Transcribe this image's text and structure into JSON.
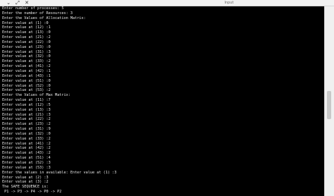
{
  "window": {
    "title": "Input",
    "buttons": [
      "⌄",
      "⤢",
      "✕"
    ]
  },
  "terminal": {
    "lines": [
      "Enter number of processes: 5",
      "Enter the number of Resources: 3",
      "Enter the Values of Allocation Matrix:",
      "Enter value at (1) :0",
      "Enter value at (12) :1",
      "Enter value at (13) :0",
      "Enter value at (21) :2",
      "Enter value at (22) :0",
      "Enter value at (23) :0",
      "Enter value at (31) :3",
      "Enter value at (32) :0",
      "Enter value at (33) :2",
      "Enter value at (41) :2",
      "Enter value at (42) :1",
      "Enter value at (43) :1",
      "Enter value at (51) :0",
      "Enter value at (52) :0",
      "Enter value at (53) :2",
      "Enter the Values of Max Matrix:",
      "Enter value at (11) :7",
      "Enter value at (12) :5",
      "Enter value at (13) :3",
      "Enter value at (21) :3",
      "Enter value at (22) :2",
      "Enter value at (23) :2",
      "Enter value at (31) :9",
      "Enter value at (32) :0",
      "Enter value at (33) :2",
      "Enter value at (41) :2",
      "Enter value at (42) :2",
      "Enter value at (43) :2",
      "Enter value at (51) :4",
      "Enter value at (52) :3",
      "Enter value at (53) :3",
      "Enter the values in available: Enter value at (1) :3",
      "Enter value at (2) :3",
      "Enter value at (3) :2",
      "The SAFE SEQUENCE is:",
      " P1 -> P3 -> P4 -> P0 -> P2"
    ]
  }
}
